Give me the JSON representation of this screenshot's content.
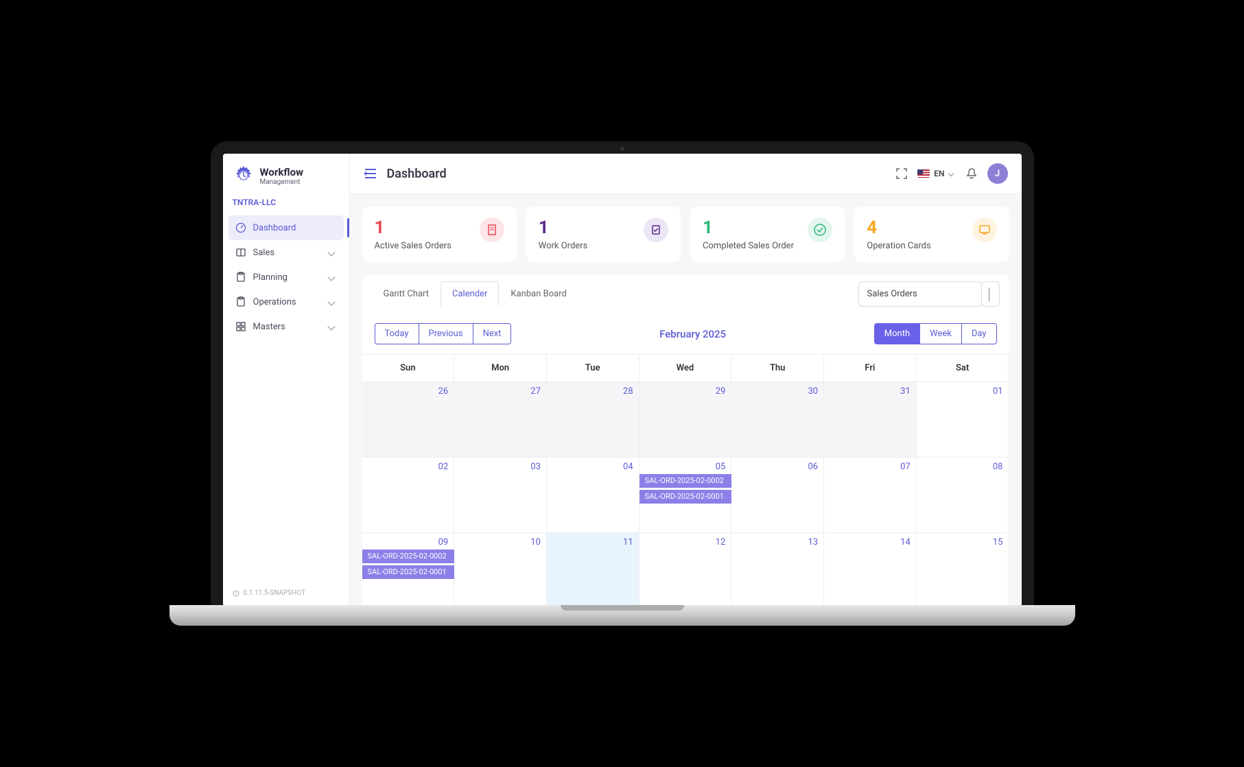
{
  "brand": {
    "title": "Workflow",
    "subtitle": "Management"
  },
  "org": "TNTRA-LLC",
  "sidebar": {
    "items": [
      {
        "label": "Dashboard",
        "active": true
      },
      {
        "label": "Sales"
      },
      {
        "label": "Planning"
      },
      {
        "label": "Operations"
      },
      {
        "label": "Masters"
      }
    ]
  },
  "version": "0.1.11.5-SNAPSHOT",
  "header": {
    "title": "Dashboard",
    "language": "EN",
    "avatar_initial": "J"
  },
  "cards": [
    {
      "count": "1",
      "label": "Active Sales Orders",
      "color": "#E84855",
      "icon_bg": "#FDE4E6"
    },
    {
      "count": "1",
      "label": "Work Orders",
      "color": "#5B2A86",
      "icon_bg": "#ECE5F6"
    },
    {
      "count": "1",
      "label": "Completed Sales Order",
      "color": "#2BB673",
      "icon_bg": "#E3F6ED"
    },
    {
      "count": "4",
      "label": "Operation Cards",
      "color": "#F5A623",
      "icon_bg": "#FEF3E0"
    }
  ],
  "tabs": [
    {
      "label": "Gantt Chart",
      "active": false
    },
    {
      "label": "Calender",
      "active": true
    },
    {
      "label": "Kanban Board",
      "active": false
    }
  ],
  "dropdown": {
    "selected": "Sales Orders"
  },
  "calendar": {
    "nav": {
      "today": "Today",
      "prev": "Previous",
      "next": "Next"
    },
    "title": "February 2025",
    "views": [
      {
        "label": "Month",
        "active": true
      },
      {
        "label": "Week",
        "active": false
      },
      {
        "label": "Day",
        "active": false
      }
    ],
    "days": [
      "Sun",
      "Mon",
      "Tue",
      "Wed",
      "Thu",
      "Fri",
      "Sat"
    ],
    "weeks": [
      [
        "26",
        "27",
        "28",
        "29",
        "30",
        "31",
        "01"
      ],
      [
        "02",
        "03",
        "04",
        "05",
        "06",
        "07",
        "08"
      ],
      [
        "09",
        "10",
        "11",
        "12",
        "13",
        "14",
        "15"
      ]
    ],
    "events": {
      "w1e1": "SAL-ORD-2025-02-0002",
      "w1e2": "SAL-ORD-2025-02-0001",
      "w2e1": "SAL-ORD-2025-02-0002",
      "w2e2": "SAL-ORD-2025-02-0001"
    }
  }
}
